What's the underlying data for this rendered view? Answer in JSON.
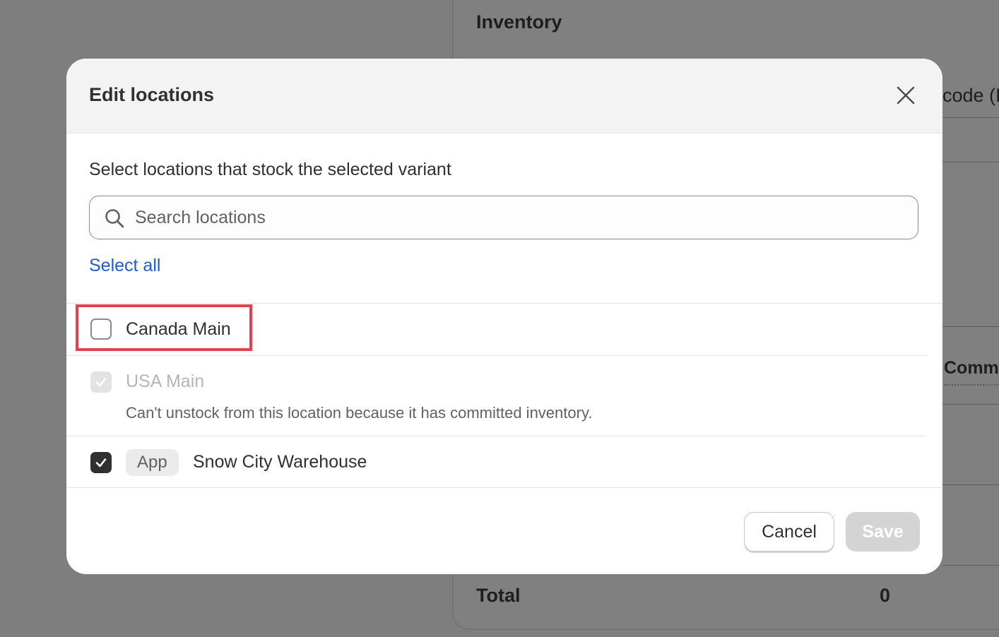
{
  "background": {
    "heading": "Inventory",
    "code_label_fragment": "code (I",
    "committed_fragment": "Comm",
    "total_label": "Total",
    "total_value": "0"
  },
  "modal": {
    "title": "Edit locations",
    "close_icon": "close-icon",
    "subtitle": "Select locations that stock the selected variant",
    "search": {
      "icon": "search-icon",
      "placeholder": "Search locations",
      "value": ""
    },
    "select_all_label": "Select all",
    "locations": [
      {
        "label": "Canada Main",
        "checked": false,
        "disabled": false
      },
      {
        "label": "USA Main",
        "checked": true,
        "disabled": true,
        "help_text": "Can't unstock from this location because it has committed inventory."
      },
      {
        "label": "Snow City Warehouse",
        "checked": true,
        "disabled": false,
        "badge": "App"
      }
    ],
    "footer": {
      "cancel_label": "Cancel",
      "save_label": "Save"
    }
  },
  "colors": {
    "overlay": "#7e7e7e",
    "link": "#1f5ccf",
    "highlight": "#e0424f",
    "checkbox_checked": "#303030",
    "save_disabled": "#d4d4d4"
  }
}
